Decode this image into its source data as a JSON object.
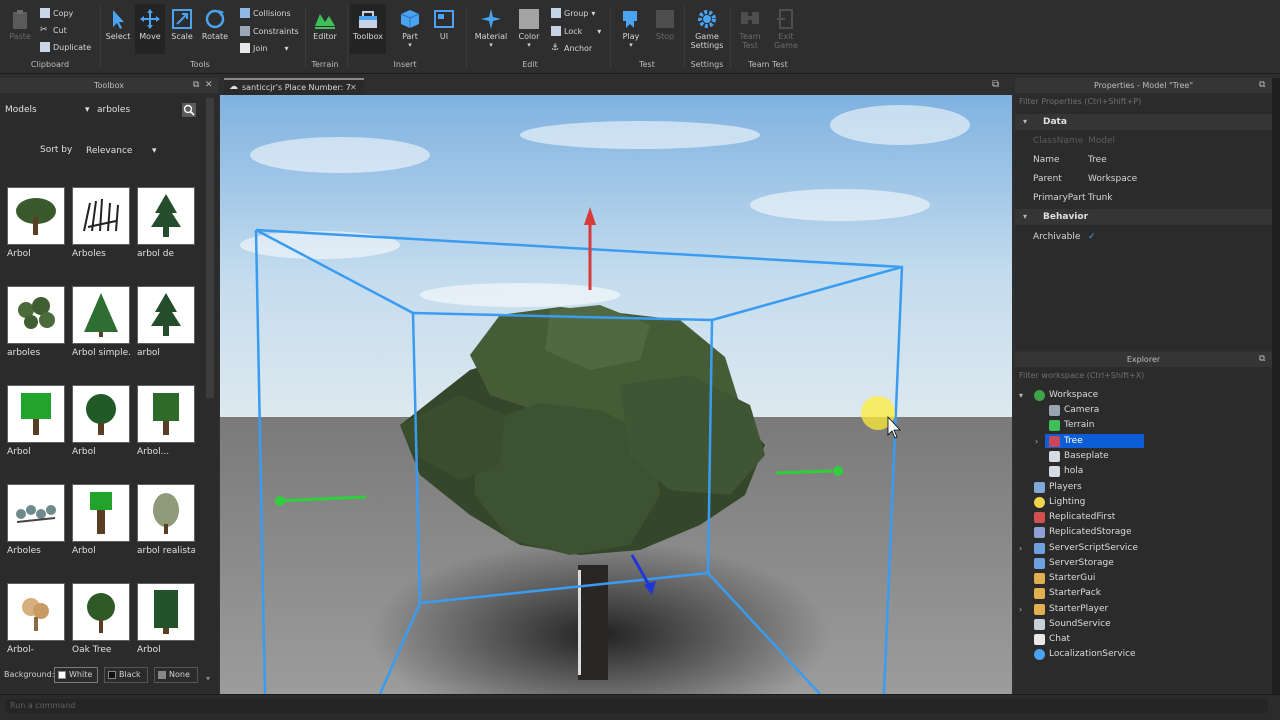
{
  "ribbon": {
    "clipboard": {
      "paste": "Paste",
      "copy": "Copy",
      "cut": "Cut",
      "duplicate": "Duplicate",
      "group": "Clipboard"
    },
    "tools": {
      "select": "Select",
      "move": "Move",
      "scale": "Scale",
      "rotate": "Rotate",
      "collisions": "Collisions",
      "constraints": "Constraints",
      "join": "Join",
      "group": "Tools"
    },
    "terrain": {
      "editor": "Editor",
      "group": "Terrain"
    },
    "insert": {
      "toolbox": "Toolbox",
      "part": "Part",
      "ui": "UI",
      "group": "Insert"
    },
    "edit": {
      "material": "Material",
      "color": "Color",
      "group_btn": "Group",
      "lock": "Lock",
      "anchor": "Anchor",
      "group": "Edit"
    },
    "test": {
      "play": "Play",
      "stop": "Stop",
      "group": "Test"
    },
    "settings": {
      "game_settings_1": "Game",
      "game_settings_2": "Settings",
      "group": "Settings"
    },
    "team_test": {
      "team_test_1": "Team",
      "team_test_2": "Test",
      "exit_game_1": "Exit",
      "exit_game_2": "Game",
      "group": "Team Test"
    }
  },
  "toolbox": {
    "title": "Toolbox",
    "category": "Models",
    "search_value": "arboles",
    "sort_label": "Sort by",
    "sort_value": "Relevance",
    "assets": [
      {
        "label": "Arbol"
      },
      {
        "label": "Arboles"
      },
      {
        "label": "arbol de"
      },
      {
        "label": "arboles"
      },
      {
        "label": "Arbol simple."
      },
      {
        "label": "arbol"
      },
      {
        "label": "Arbol"
      },
      {
        "label": "Arbol"
      },
      {
        "label": "Arbol..."
      },
      {
        "label": "Arboles"
      },
      {
        "label": "Arbol"
      },
      {
        "label": "arbol realista"
      },
      {
        "label": "Arbol-"
      },
      {
        "label": "Oak Tree"
      },
      {
        "label": "Arbol"
      }
    ],
    "background_label": "Background:",
    "bg_white": "White",
    "bg_black": "Black",
    "bg_none": "None"
  },
  "viewport": {
    "tab_title": "santiccjr's Place Number: 7"
  },
  "properties": {
    "title": "Properties - Model \"Tree\"",
    "filter_placeholder": "Filter Properties (Ctrl+Shift+P)",
    "section_data": "Data",
    "rows": [
      {
        "key": "ClassName",
        "value": "Model"
      },
      {
        "key": "Name",
        "value": "Tree"
      },
      {
        "key": "Parent",
        "value": "Workspace"
      },
      {
        "key": "PrimaryPart",
        "value": "Trunk"
      }
    ],
    "section_behavior": "Behavior",
    "archivable_key": "Archivable",
    "archivable_value": "✓"
  },
  "explorer": {
    "title": "Explorer",
    "filter_placeholder": "Filter workspace (Ctrl+Shift+X)",
    "items": [
      {
        "label": "Workspace"
      },
      {
        "label": "Camera"
      },
      {
        "label": "Terrain"
      },
      {
        "label": "Tree"
      },
      {
        "label": "Baseplate"
      },
      {
        "label": "hola"
      },
      {
        "label": "Players"
      },
      {
        "label": "Lighting"
      },
      {
        "label": "ReplicatedFirst"
      },
      {
        "label": "ReplicatedStorage"
      },
      {
        "label": "ServerScriptService"
      },
      {
        "label": "ServerStorage"
      },
      {
        "label": "StarterGui"
      },
      {
        "label": "StarterPack"
      },
      {
        "label": "StarterPlayer"
      },
      {
        "label": "SoundService"
      },
      {
        "label": "Chat"
      },
      {
        "label": "LocalizationService"
      }
    ]
  },
  "command_bar": {
    "placeholder": "Run a command"
  },
  "colors": {
    "accent": "#0d5dd6",
    "selection_box": "#3a9cf0",
    "panel": "#2b2b2b"
  }
}
